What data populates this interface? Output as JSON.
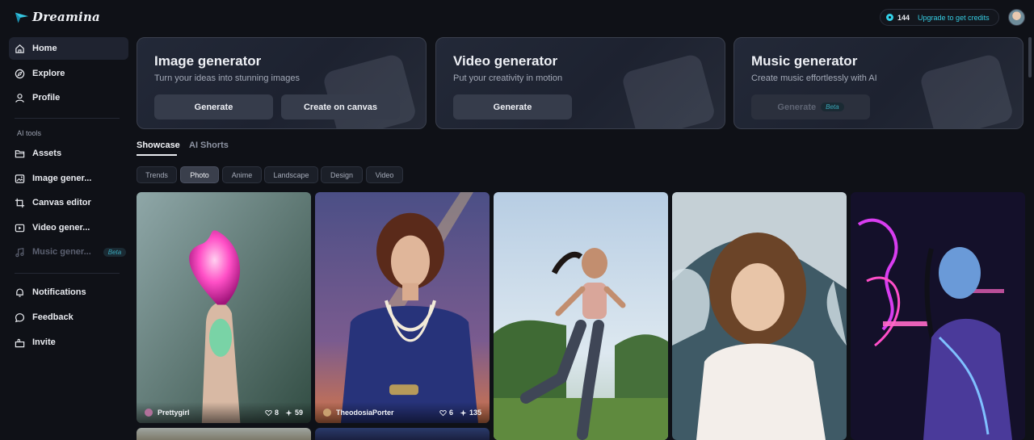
{
  "app": {
    "name": "Dreamina"
  },
  "sidebar": {
    "items": [
      {
        "label": "Home",
        "icon": "home-icon",
        "active": true
      },
      {
        "label": "Explore",
        "icon": "compass-icon"
      },
      {
        "label": "Profile",
        "icon": "user-icon"
      }
    ],
    "section_label": "AI tools",
    "tools": [
      {
        "label": "Assets",
        "icon": "folder-icon"
      },
      {
        "label": "Image gener...",
        "icon": "image-icon"
      },
      {
        "label": "Canvas editor",
        "icon": "crop-icon"
      },
      {
        "label": "Video gener...",
        "icon": "video-icon"
      },
      {
        "label": "Music gener...",
        "icon": "music-icon",
        "disabled": true,
        "badge": "Beta"
      }
    ],
    "bottom": [
      {
        "label": "Notifications",
        "icon": "bell-icon"
      },
      {
        "label": "Feedback",
        "icon": "chat-icon"
      },
      {
        "label": "Invite",
        "icon": "gift-icon"
      }
    ]
  },
  "topbar": {
    "credits": "144",
    "upgrade_label": "Upgrade to get credits"
  },
  "generators": [
    {
      "title": "Image generator",
      "subtitle": "Turn your ideas into stunning images",
      "buttons": [
        "Generate",
        "Create on canvas"
      ]
    },
    {
      "title": "Video generator",
      "subtitle": "Put your creativity in motion",
      "buttons": [
        "Generate"
      ]
    },
    {
      "title": "Music generator",
      "subtitle": "Create music effortlessly with AI",
      "buttons": [
        "Generate"
      ],
      "badge": "Beta"
    }
  ],
  "tabs": [
    "Showcase",
    "AI Shorts"
  ],
  "chips": [
    "Trends",
    "Photo",
    "Anime",
    "Landscape",
    "Design",
    "Video"
  ],
  "gallery": [
    {
      "author": "Prettygirl",
      "likes": "8",
      "uses": "59"
    },
    {
      "author": "TheodosiaPorter",
      "likes": "6",
      "uses": "135"
    }
  ],
  "colors": {
    "accent": "#36cde3",
    "background": "#0f1117",
    "card": "#1d2230"
  }
}
